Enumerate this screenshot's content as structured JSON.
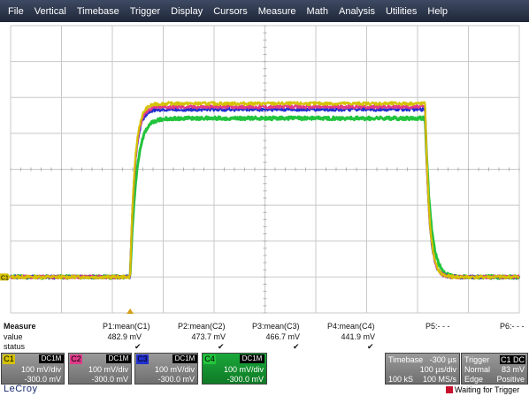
{
  "menu": [
    "File",
    "Vertical",
    "Timebase",
    "Trigger",
    "Display",
    "Cursors",
    "Measure",
    "Math",
    "Analysis",
    "Utilities",
    "Help"
  ],
  "colors": {
    "c1": "#d4c200",
    "c2": "#e03a8a",
    "c3": "#2030d0",
    "c4": "#22c43c"
  },
  "chart_data": {
    "type": "line",
    "x_divisions": 10,
    "y_divisions": 8,
    "x_unit_per_div": "100 µs/div",
    "y_unit_per_div": "100 mV/div",
    "x_range_us": [
      -500,
      500
    ],
    "y_range_mV": [
      -100,
      700
    ],
    "grid": true,
    "pulse": {
      "rise_start_us": -265,
      "fall_start_us": 315,
      "baseline_mV": 0
    },
    "series": [
      {
        "name": "C1",
        "color": "#d4c200",
        "high_mV": 482.9
      },
      {
        "name": "C2",
        "color": "#e03a8a",
        "high_mV": 473.7
      },
      {
        "name": "C3",
        "color": "#2030d0",
        "high_mV": 466.7
      },
      {
        "name": "C4",
        "color": "#22c43c",
        "high_mV": 441.9
      }
    ],
    "ground_marker": "C1",
    "trigger_marker": "T"
  },
  "measure": {
    "heading": "Measure",
    "row_value": "value",
    "row_status": "status",
    "params": [
      {
        "label": "P1:mean(C1)",
        "value": "482.9 mV",
        "status": "✔"
      },
      {
        "label": "P2:mean(C2)",
        "value": "473.7 mV",
        "status": "✔"
      },
      {
        "label": "P3:mean(C3)",
        "value": "466.7 mV",
        "status": "✔"
      },
      {
        "label": "P4:mean(C4)",
        "value": "441.9 mV",
        "status": "✔"
      },
      {
        "label": "P5:- - -",
        "value": "",
        "status": ""
      },
      {
        "label": "P6:- - -",
        "value": "",
        "status": ""
      }
    ]
  },
  "channels": [
    {
      "tag": "C1",
      "coupling": "DC1M",
      "vdiv": "100 mV/div",
      "offset": "-300.0 mV",
      "color": "#d4c200"
    },
    {
      "tag": "C2",
      "coupling": "DC1M",
      "vdiv": "100 mV/div",
      "offset": "-300.0 mV",
      "color": "#e03a8a"
    },
    {
      "tag": "C3",
      "coupling": "DC1M",
      "vdiv": "100 mV/div",
      "offset": "-300.0 mV",
      "color": "#2030d0"
    },
    {
      "tag": "C4",
      "coupling": "DC1M",
      "vdiv": "100 mV/div",
      "offset": "-300.0 mV",
      "color": "#22c43c"
    }
  ],
  "timebase": {
    "label": "Timebase",
    "delay": "-300 µs",
    "tdiv": "100 µs/div",
    "samples": "100 kS",
    "rate": "100 MS/s"
  },
  "trigger": {
    "label": "Trigger",
    "source": "C1 DC",
    "mode": "Normal",
    "level": "83 mV",
    "type": "Edge",
    "slope": "Positive"
  },
  "brand": "LeCroy",
  "status": "Waiting for Trigger"
}
